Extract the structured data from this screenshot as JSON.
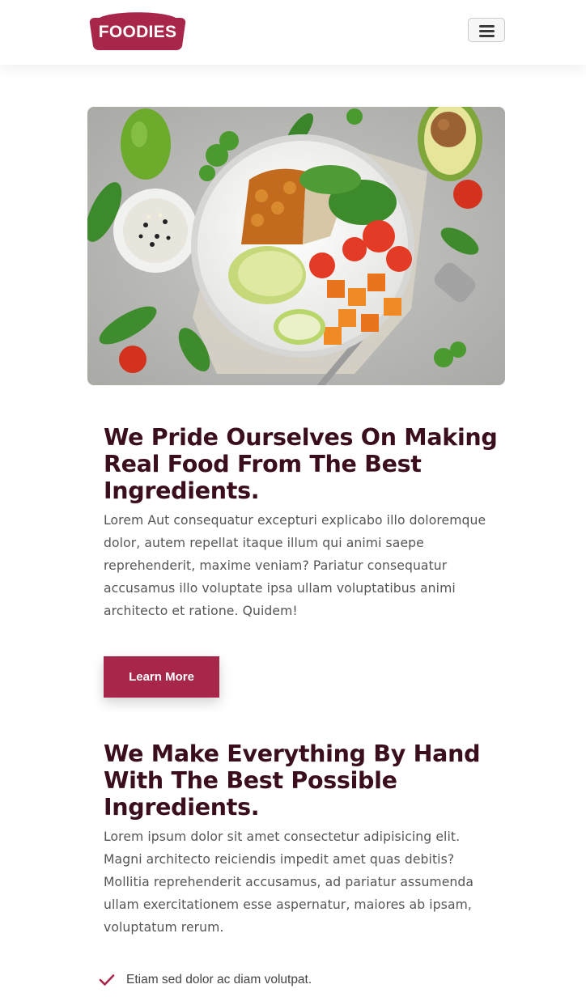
{
  "header": {
    "logo_text": "FOODIES",
    "menu_icon": "hamburger-menu-icon"
  },
  "hero": {
    "image": "salad-bowl-photo"
  },
  "section1": {
    "title": "We Pride Ourselves On Making Real Food From The Best Ingredients.",
    "body": "Lorem Aut consequatur excepturi explicabo illo doloremque dolor, autem repellat itaque illum qui animi saepe reprehenderit, maxime veniam? Pariatur consequatur accusamus illo voluptate ipsa ullam voluptatibus animi architecto et ratione. Quidem!",
    "button_label": "Learn More"
  },
  "section2": {
    "title": "We Make Everything By Hand With The Best Possible Ingredients.",
    "body": "Lorem ipsum dolor sit amet consectetur adipisicing elit. Magni architecto reiciendis impedit amet quas debitis? Mollitia reprehenderit accusamus, ad pariatur assumenda ullam exercitationem esse aspernatur, maiores ab ipsam, voluptatum rerum.",
    "checklist": [
      {
        "icon": "check-icon",
        "text": "Etiam sed dolor ac diam volutpat."
      }
    ]
  },
  "colors": {
    "brand": "#a8264a",
    "heading": "#3a0e1d",
    "body_text": "#555555"
  }
}
